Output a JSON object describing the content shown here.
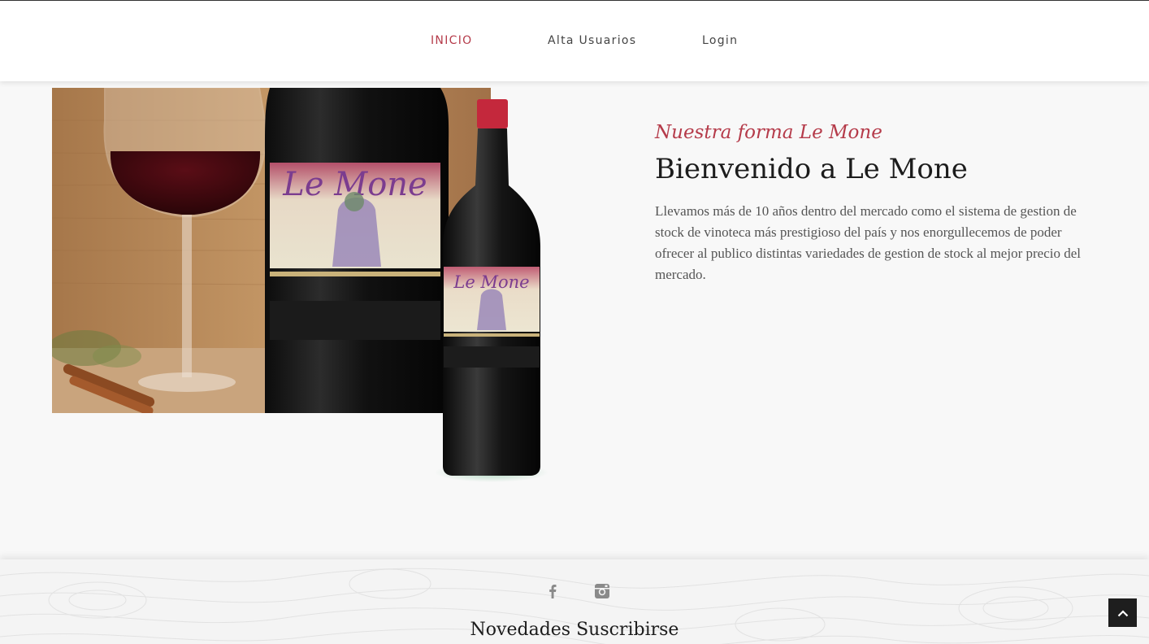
{
  "nav": {
    "items": [
      {
        "label": "INICIO",
        "active": true
      },
      {
        "label": "Alta Usuarios",
        "active": false
      },
      {
        "label": "Login",
        "active": false
      }
    ]
  },
  "hero": {
    "label_text": "Le Mone",
    "kicker": "Nuestra forma Le Mone",
    "title": "Bienvenido a Le Mone",
    "body": "Llevamos más de 10 años dentro del mercado como el sistema de gestion de stock de vinoteca más prestigioso del país y nos enorgullecemos de poder ofrecer al publico distintas variedades de gestion de stock al mejor precio del mercado."
  },
  "footer": {
    "social_icons": [
      "facebook-icon",
      "instagram-icon"
    ],
    "title": "Novedades Suscribirse"
  },
  "back_to_top_icon": "chevron-up-icon",
  "colors": {
    "accent": "#b53b4a",
    "navbar_bg": "#ffffff",
    "page_bg": "#f8f8f8",
    "back_to_top_bg": "#1e1e1e"
  }
}
